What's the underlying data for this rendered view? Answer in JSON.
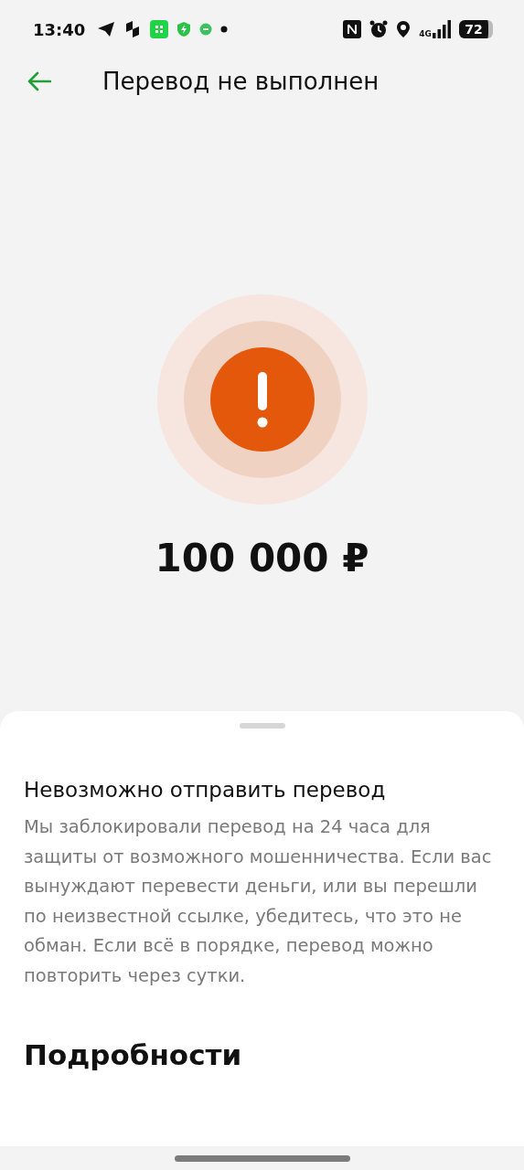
{
  "status_bar": {
    "time": "13:40",
    "network": "4G",
    "battery": "72"
  },
  "header": {
    "title": "Перевод не выполнен"
  },
  "status": {
    "kind": "error",
    "amount": "100 000 ₽"
  },
  "sheet": {
    "title": "Невозможно отправить перевод",
    "message": "Мы заблокировали перевод на 24 часа для защиты от возможного мошенничества. Если вас вынуждают перевести деньги, или вы перешли по неизвестной ссылке, убедитесь, что это не обман. Если всё в порядке, перевод можно повторить через сутки.",
    "details_title": "Подробности"
  }
}
